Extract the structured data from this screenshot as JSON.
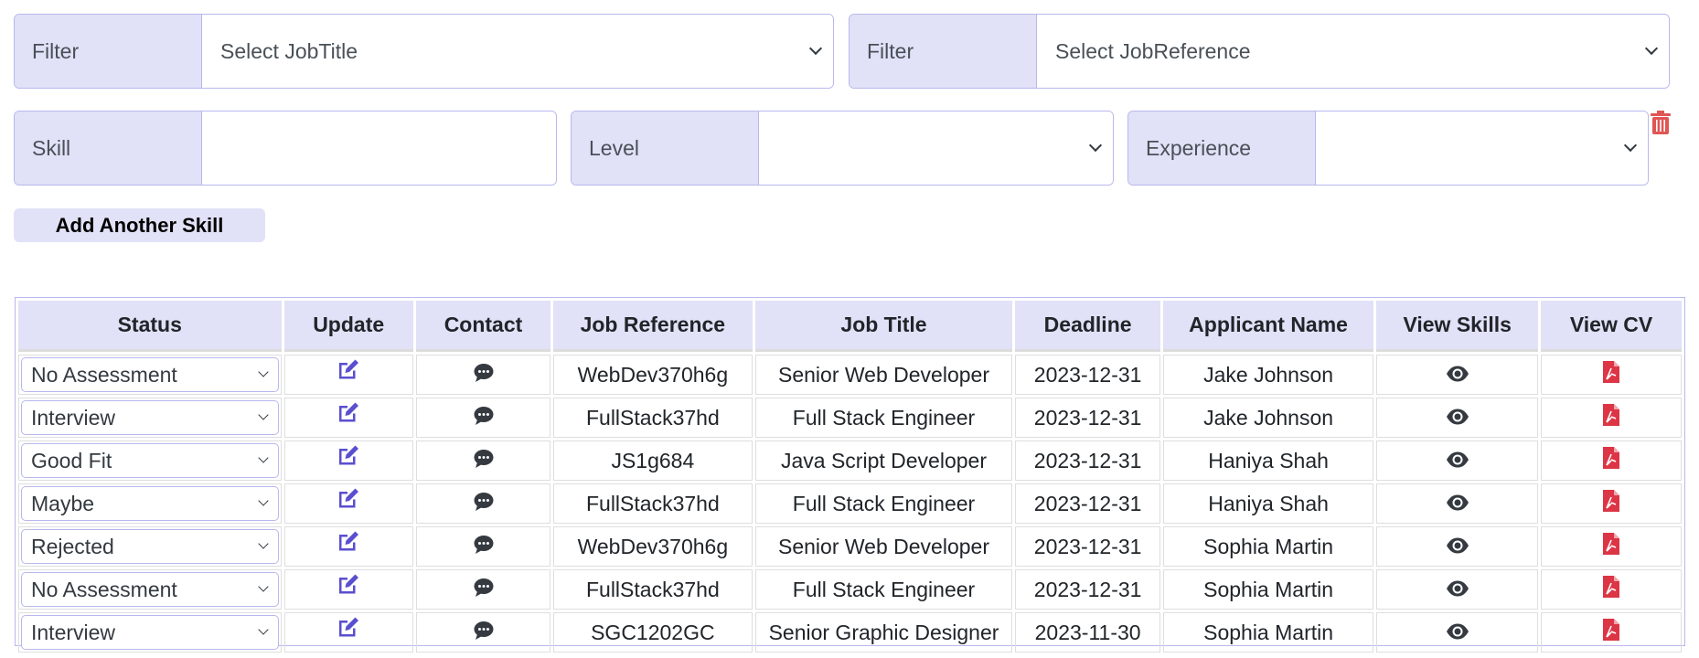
{
  "filters": {
    "job_title": {
      "label": "Filter",
      "selected": "Select JobTitle"
    },
    "job_reference": {
      "label": "Filter",
      "selected": "Select JobReference"
    }
  },
  "skill_row": {
    "skill": {
      "label": "Skill",
      "value": ""
    },
    "level": {
      "label": "Level",
      "selected": ""
    },
    "experience": {
      "label": "Experience",
      "selected": ""
    },
    "delete_icon": "trash-icon"
  },
  "add_skill_button": "Add Another Skill",
  "colors": {
    "accent": "#e1e1f7",
    "border": "#b8b8ee",
    "edit_icon": "#5a4fcf",
    "pdf_icon": "#dc3545",
    "trash_icon": "#e05555"
  },
  "table": {
    "headers": [
      "Status",
      "Update",
      "Contact",
      "Job Reference",
      "Job Title",
      "Deadline",
      "Applicant Name",
      "View Skills",
      "View CV"
    ],
    "rows": [
      {
        "status": "No Assessment",
        "job_reference": "WebDev370h6g",
        "job_title": "Senior Web Developer",
        "deadline": "2023-12-31",
        "applicant": "Jake Johnson"
      },
      {
        "status": "Interview",
        "job_reference": "FullStack37hd",
        "job_title": "Full Stack Engineer",
        "deadline": "2023-12-31",
        "applicant": "Jake Johnson"
      },
      {
        "status": "Good Fit",
        "job_reference": "JS1g684",
        "job_title": "Java Script Developer",
        "deadline": "2023-12-31",
        "applicant": "Haniya Shah"
      },
      {
        "status": "Maybe",
        "job_reference": "FullStack37hd",
        "job_title": "Full Stack Engineer",
        "deadline": "2023-12-31",
        "applicant": "Haniya Shah"
      },
      {
        "status": "Rejected",
        "job_reference": "WebDev370h6g",
        "job_title": "Senior Web Developer",
        "deadline": "2023-12-31",
        "applicant": "Sophia Martin"
      },
      {
        "status": "No Assessment",
        "job_reference": "FullStack37hd",
        "job_title": "Full Stack Engineer",
        "deadline": "2023-12-31",
        "applicant": "Sophia Martin"
      },
      {
        "status": "Interview",
        "job_reference": "SGC1202GC",
        "job_title": "Senior Graphic Designer",
        "deadline": "2023-11-30",
        "applicant": "Sophia Martin"
      }
    ],
    "row_icons": {
      "update": "edit-icon",
      "contact": "chat-icon",
      "view_skills": "eye-icon",
      "view_cv": "pdf-icon"
    }
  }
}
